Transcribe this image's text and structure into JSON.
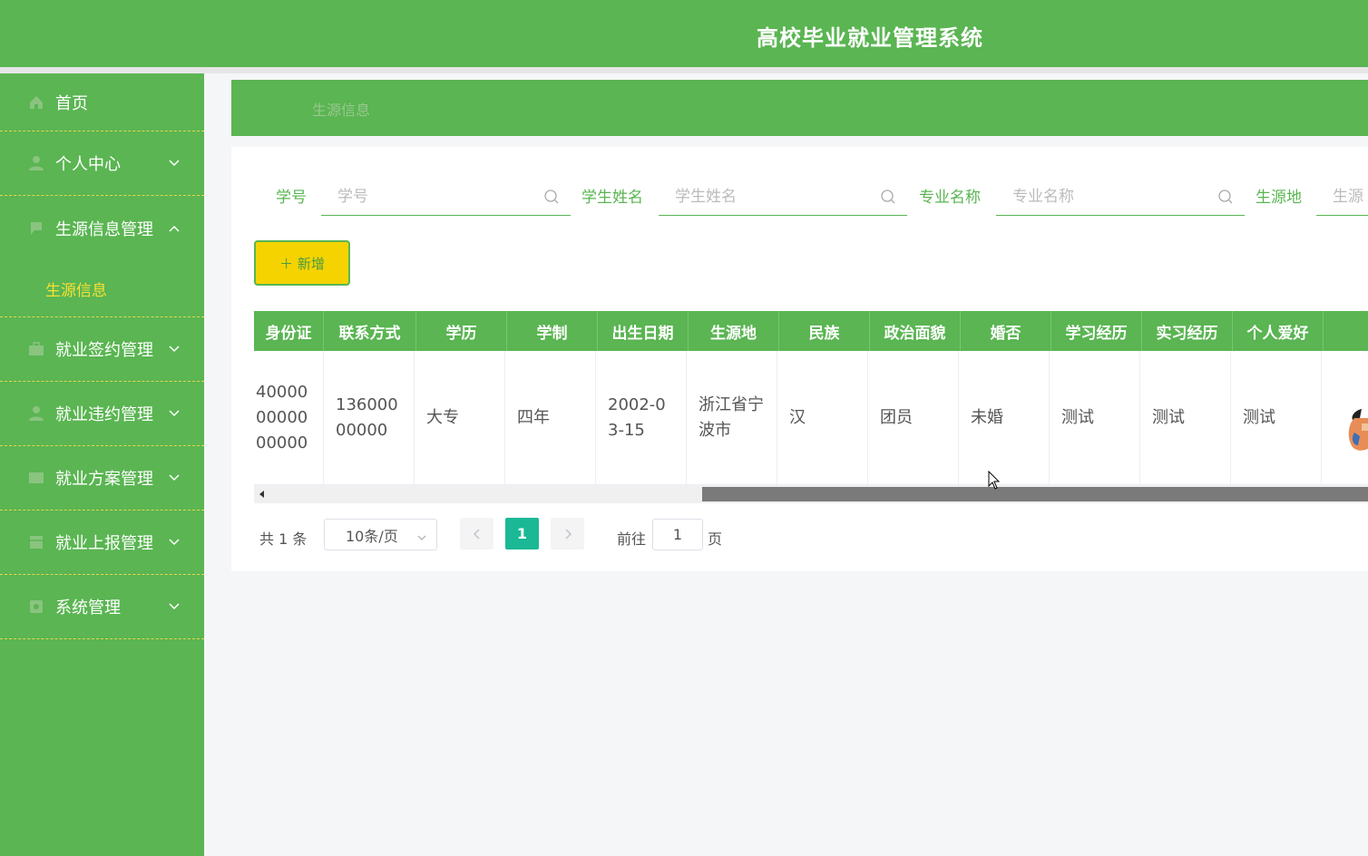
{
  "app": {
    "title": "高校毕业就业管理系统"
  },
  "colors": {
    "primary": "#5ab552",
    "accent_yellow": "#f5d300",
    "pager_active": "#1bb896"
  },
  "sidebar": {
    "items": [
      {
        "label": "首页",
        "icon": "home-icon"
      },
      {
        "label": "个人中心",
        "icon": "user-icon",
        "chevron": "down"
      },
      {
        "label": "生源信息管理",
        "icon": "flag-icon",
        "chevron": "up",
        "expanded": true,
        "children": [
          {
            "label": "生源信息"
          }
        ]
      },
      {
        "label": "就业签约管理",
        "icon": "briefcase-icon",
        "chevron": "down"
      },
      {
        "label": "就业违约管理",
        "icon": "user-icon",
        "chevron": "down"
      },
      {
        "label": "就业方案管理",
        "icon": "document-icon",
        "chevron": "down"
      },
      {
        "label": "就业上报管理",
        "icon": "calendar-icon",
        "chevron": "down"
      },
      {
        "label": "系统管理",
        "icon": "settings-icon",
        "chevron": "down"
      }
    ]
  },
  "breadcrumb": {
    "current": "生源信息"
  },
  "search": {
    "fields": [
      {
        "label": "学号",
        "placeholder": "学号"
      },
      {
        "label": "学生姓名",
        "placeholder": "学生姓名"
      },
      {
        "label": "专业名称",
        "placeholder": "专业名称"
      },
      {
        "label": "生源地",
        "placeholder": "生源"
      }
    ]
  },
  "toolbar": {
    "add_label": "＋ 新增"
  },
  "table": {
    "columns": [
      "身份证",
      "联系方式",
      "学历",
      "学制",
      "出生日期",
      "生源地",
      "民族",
      "政治面貌",
      "婚否",
      "学习经历",
      "实习经历",
      "个人爱好",
      ""
    ],
    "rows": [
      [
        "400000000000000",
        "13600000000",
        "大专",
        "四年",
        "2002-03-15",
        "浙江省宁波市",
        "汉",
        "团员",
        "未婚",
        "测试",
        "测试",
        "测试",
        ""
      ]
    ]
  },
  "pagination": {
    "total_text": "共 1 条",
    "page_size": "10条/页",
    "current_page": "1",
    "goto_label": "前往",
    "goto_value": "1",
    "page_suffix": "页"
  }
}
